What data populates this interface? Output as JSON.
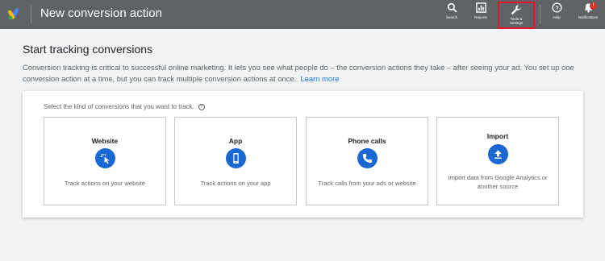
{
  "header": {
    "title": "New conversion action",
    "tools": [
      {
        "label": "Search",
        "icon": "search-icon"
      },
      {
        "label": "Reports",
        "icon": "reports-icon"
      },
      {
        "label": "Tools &\nSettings",
        "icon": "wrench-icon"
      },
      {
        "label": "Help",
        "icon": "help-icon"
      },
      {
        "label": "Notifications",
        "icon": "bell-icon",
        "badge": "!"
      }
    ]
  },
  "main": {
    "heading": "Start tracking conversions",
    "description": "Conversion tracking is critical to successful online marketing. It lets you see what people do – the conversion actions they take – after seeing your ad. You set up one conversion action at a time, but you can track multiple conversion actions at once.",
    "learn_more": "Learn more",
    "prompt": "Select the kind of conversions that you want to track.",
    "prompt_help": "?",
    "cards": [
      {
        "title": "Website",
        "text": "Track actions on your website",
        "icon": "cursor-click-icon"
      },
      {
        "title": "App",
        "text": "Track actions on your app",
        "icon": "mobile-phone-icon"
      },
      {
        "title": "Phone calls",
        "text": "Track calls from your ads or website",
        "icon": "phone-icon"
      },
      {
        "title": "Import",
        "text": "Import data from Google Analytics or another source",
        "icon": "upload-icon"
      }
    ]
  },
  "colors": {
    "topbar": "#5f6368",
    "accent": "#1a73e8",
    "icon_circle": "#1967d2",
    "highlight_box": "#e8132c",
    "background": "#f1f3f4"
  }
}
